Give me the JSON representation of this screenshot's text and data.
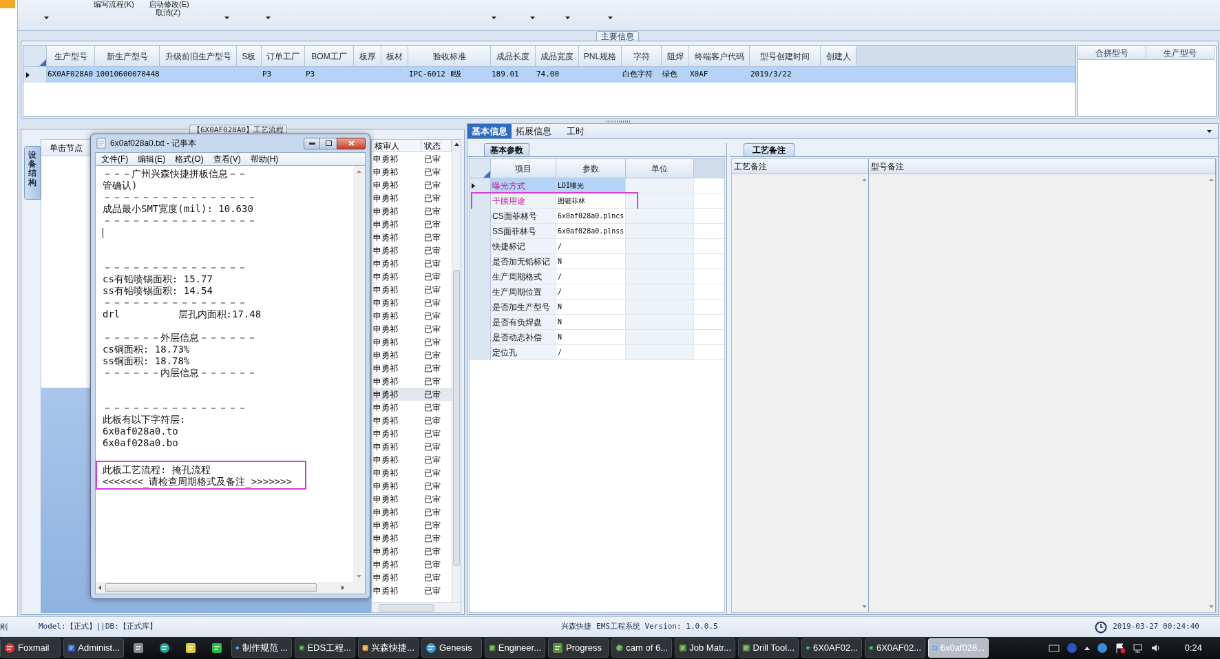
{
  "toolbar": {
    "items": [
      "编写流程(K)",
      "启动修改(E)",
      "取消(Z)"
    ]
  },
  "main_info": {
    "title": "主要信息",
    "columns": [
      "生产型号",
      "新生产型号",
      "升级前旧生产型号",
      "S板",
      "订单工厂",
      "BOM工厂",
      "板厚",
      "板材",
      "验收标准",
      "成品长度",
      "成品宽度",
      "PNL规格",
      "字符",
      "阻焊",
      "终端客户代码",
      "型号创建时间",
      "创建人"
    ],
    "rows": [
      {
        "selected": true,
        "cells": [
          "6X0AF028A0",
          "10010600070448",
          null,
          null,
          "P3",
          "P3",
          null,
          null,
          "IPC-6012 Ⅱ级",
          "189.01",
          "74.00",
          null,
          "白色字符",
          "绿色",
          "X0AF",
          "2019/3/22",
          null
        ]
      }
    ],
    "merge_columns": [
      "合拼型号",
      "生产型号"
    ]
  },
  "process_panel": {
    "title": "【6X0AF028A0】工艺流程",
    "side_tab": "设备结构",
    "tree_header": "单击节点",
    "list_columns": [
      "核审人",
      "状态"
    ],
    "rows": [
      {
        "reviewer": "申勇祁",
        "status": "已审",
        "selected": false
      },
      {
        "reviewer": "申勇祁",
        "status": "已审",
        "selected": false
      },
      {
        "reviewer": "申勇祁",
        "status": "已审",
        "selected": false
      },
      {
        "reviewer": "申勇祁",
        "status": "已审",
        "selected": false
      },
      {
        "reviewer": "申勇祁",
        "status": "已审",
        "selected": false
      },
      {
        "reviewer": "申勇祁",
        "status": "已审",
        "selected": false
      },
      {
        "reviewer": "申勇祁",
        "status": "已审",
        "selected": false
      },
      {
        "reviewer": "申勇祁",
        "status": "已审",
        "selected": false
      },
      {
        "reviewer": "申勇祁",
        "status": "已审",
        "selected": false
      },
      {
        "reviewer": "申勇祁",
        "status": "已审",
        "selected": false
      },
      {
        "reviewer": "申勇祁",
        "status": "已审",
        "selected": false
      },
      {
        "reviewer": "申勇祁",
        "status": "已审",
        "selected": false
      },
      {
        "reviewer": "申勇祁",
        "status": "已审",
        "selected": false
      },
      {
        "reviewer": "申勇祁",
        "status": "已审",
        "selected": false
      },
      {
        "reviewer": "申勇祁",
        "status": "已审",
        "selected": false
      },
      {
        "reviewer": "申勇祁",
        "status": "已审",
        "selected": false
      },
      {
        "reviewer": "申勇祁",
        "status": "已审",
        "selected": false
      },
      {
        "reviewer": "申勇祁",
        "status": "已审",
        "selected": false
      },
      {
        "reviewer": "申勇祁",
        "status": "已审",
        "selected": true
      },
      {
        "reviewer": "申勇祁",
        "status": "已审",
        "selected": false
      },
      {
        "reviewer": "申勇祁",
        "status": "已审",
        "selected": false
      },
      {
        "reviewer": "申勇祁",
        "status": "已审",
        "selected": false
      },
      {
        "reviewer": "申勇祁",
        "status": "已审",
        "selected": false
      },
      {
        "reviewer": "申勇祁",
        "status": "已审",
        "selected": false
      },
      {
        "reviewer": "申勇祁",
        "status": "已审",
        "selected": false
      },
      {
        "reviewer": "申勇祁",
        "status": "已审",
        "selected": false
      },
      {
        "reviewer": "申勇祁",
        "status": "已审",
        "selected": false
      },
      {
        "reviewer": "申勇祁",
        "status": "已审",
        "selected": false
      },
      {
        "reviewer": "申勇祁",
        "status": "已审",
        "selected": false
      },
      {
        "reviewer": "申勇祁",
        "status": "已审",
        "selected": false
      },
      {
        "reviewer": "申勇祁",
        "status": "已审",
        "selected": false
      },
      {
        "reviewer": "申勇祁",
        "status": "已审",
        "selected": false
      },
      {
        "reviewer": "申勇祁",
        "status": "已审",
        "selected": false
      },
      {
        "reviewer": "申勇祁",
        "status": "已审",
        "selected": false
      }
    ]
  },
  "notepad": {
    "title": "6x0af028a0.txt - 记事本",
    "menu": [
      "文件(F)",
      "编辑(E)",
      "格式(O)",
      "查看(V)",
      "帮助(H)"
    ],
    "lines": [
      {
        "kind": "text",
        "text": "－－－广州兴森快捷拼板信息－－",
        "highlighted": false
      },
      {
        "kind": "text",
        "text": "管确认)",
        "highlighted": false
      },
      {
        "kind": "text",
        "text": "－－－－－－－－－－－－－－－－",
        "highlighted": false
      },
      {
        "kind": "text",
        "text": "成品最小SMT宽度(mil): 10.630",
        "highlighted": false
      },
      {
        "kind": "text",
        "text": "－－－－－－－－－－－－－－－－",
        "highlighted": false
      },
      {
        "kind": "cursor",
        "highlighted": false
      },
      {
        "kind": "blank",
        "highlighted": false
      },
      {
        "kind": "text",
        "text": "－－－－－－－－－－－－－－－",
        "highlighted": false
      },
      {
        "kind": "text",
        "text": "cs有铅喷锡面积: 15.77",
        "highlighted": false
      },
      {
        "kind": "text",
        "text": "ss有铅喷锡面积: 14.54",
        "highlighted": false
      },
      {
        "kind": "text",
        "text": "－－－－－－－－－－－－－－－",
        "highlighted": false
      },
      {
        "kind": "text",
        "text": "drl          层孔内面积:17.48",
        "highlighted": false
      },
      {
        "kind": "blank",
        "highlighted": false
      },
      {
        "kind": "text",
        "text": "－－－－－－外层信息－－－－－－",
        "highlighted": false
      },
      {
        "kind": "text",
        "text": "cs铜面积: 18.73%",
        "highlighted": false
      },
      {
        "kind": "text",
        "text": "ss铜面积: 18.78%",
        "highlighted": false
      },
      {
        "kind": "text",
        "text": "－－－－－－内层信息－－－－－－",
        "highlighted": false
      },
      {
        "kind": "blank",
        "highlighted": false
      },
      {
        "kind": "blank",
        "highlighted": false
      },
      {
        "kind": "text",
        "text": "－－－－－－－－－－－－－－－",
        "highlighted": false
      },
      {
        "kind": "text",
        "text": "此板有以下字符层:",
        "highlighted": false
      },
      {
        "kind": "text",
        "text": "6x0af028a0.to",
        "highlighted": false
      },
      {
        "kind": "text",
        "text": "6x0af028a0.bo",
        "highlighted": false
      },
      {
        "kind": "blank",
        "highlighted": false
      },
      {
        "kind": "text",
        "text": "此板工艺流程: 掩孔流程",
        "highlighted": true
      },
      {
        "kind": "text",
        "text": "<<<<<<<_请检查周期格式及备注_>>>>>>>",
        "highlighted": true
      }
    ]
  },
  "detail_tabs": [
    {
      "label": "基本信息",
      "selected": true
    },
    {
      "label": "拓展信息",
      "selected": false
    },
    {
      "label": "工时",
      "selected": false
    }
  ],
  "basic_params": {
    "title": "基本参数",
    "columns": [
      "项目",
      "参数",
      "单位"
    ],
    "rows": [
      {
        "item": "曝光方式",
        "value": "LDI曝光",
        "selected": true,
        "flagged": true,
        "boxed": false
      },
      {
        "item": "干膜用途",
        "value": "图镀菲林",
        "selected": false,
        "flagged": true,
        "boxed": true
      },
      {
        "item": "CS面菲林号",
        "value": "6x0af028a0.plncs",
        "selected": false,
        "flagged": false,
        "boxed": false
      },
      {
        "item": "SS面菲林号",
        "value": "6x0af028a0.plnss",
        "selected": false,
        "flagged": false,
        "boxed": false
      },
      {
        "item": "快捷标记",
        "value": "/",
        "selected": false,
        "flagged": false,
        "boxed": false
      },
      {
        "item": "是否加无铅标记",
        "value": "N",
        "selected": false,
        "flagged": false,
        "boxed": false
      },
      {
        "item": "生产周期格式",
        "value": "/",
        "selected": false,
        "flagged": false,
        "boxed": false
      },
      {
        "item": "生产周期位置",
        "value": "/",
        "selected": false,
        "flagged": false,
        "boxed": false
      },
      {
        "item": "是否加生产型号",
        "value": "N",
        "selected": false,
        "flagged": false,
        "boxed": false
      },
      {
        "item": "是否有负焊盘",
        "value": "N",
        "selected": false,
        "flagged": false,
        "boxed": false
      },
      {
        "item": "是否动态补偿",
        "value": "N",
        "selected": false,
        "flagged": false,
        "boxed": false
      },
      {
        "item": "定位孔",
        "value": "/",
        "selected": false,
        "flagged": false,
        "boxed": false
      }
    ]
  },
  "process_notes": {
    "title": "工艺备注",
    "columns": [
      "工艺备注",
      "型号备注"
    ]
  },
  "status_bar": {
    "left": "刚",
    "mode": "Model:【正式】||DB:【正式库】",
    "app": "兴森快捷 EMS工程系统 Version: 1.0.0.5",
    "datetime": "2019-03-27 00:24:40"
  },
  "taskbar": {
    "items": [
      {
        "kind": "app",
        "label": "Foxmail",
        "selected": false
      },
      {
        "kind": "app",
        "label": "Administ...",
        "selected": false
      },
      {
        "kind": "icon",
        "selected": false
      },
      {
        "kind": "icon",
        "selected": false
      },
      {
        "kind": "icon",
        "selected": false
      },
      {
        "kind": "icon",
        "selected": false
      },
      {
        "kind": "app",
        "label": "制作规范 ...",
        "selected": false
      },
      {
        "kind": "app",
        "label": "EDS工程...",
        "selected": false
      },
      {
        "kind": "app",
        "label": "兴森快捷...",
        "selected": false
      },
      {
        "kind": "app",
        "label": "Genesis",
        "selected": false
      },
      {
        "kind": "app",
        "label": "Engineer...",
        "selected": false
      },
      {
        "kind": "app",
        "label": "Progress",
        "selected": false
      },
      {
        "kind": "app",
        "label": "cam of 6...",
        "selected": false
      },
      {
        "kind": "app",
        "label": "Job Matr...",
        "selected": false
      },
      {
        "kind": "app",
        "label": "Drill Tool...",
        "selected": false
      },
      {
        "kind": "app",
        "label": "6X0AF02...",
        "selected": false
      },
      {
        "kind": "app",
        "label": "6X0AF02...",
        "selected": false
      },
      {
        "kind": "app",
        "label": "6x0af028...",
        "selected": true
      }
    ],
    "clock": "0:24"
  }
}
